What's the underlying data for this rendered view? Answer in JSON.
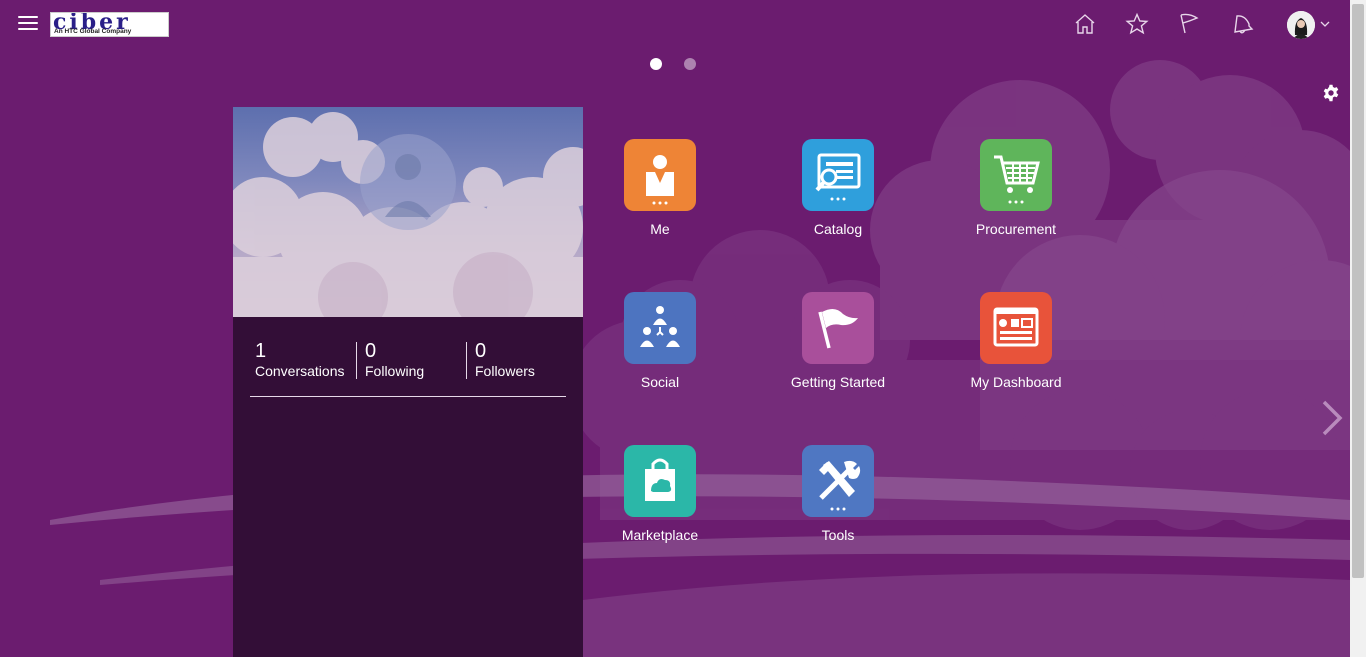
{
  "header": {
    "logo_text": "ciber",
    "logo_subtext": "An HTC Global Company",
    "icons": [
      "menu-icon",
      "home-icon",
      "star-icon",
      "flag-icon",
      "bell-icon",
      "user-avatar"
    ]
  },
  "pager": {
    "pages": 2,
    "active_index": 0
  },
  "profile": {
    "stats": [
      {
        "value": "1",
        "label": "Conversations"
      },
      {
        "value": "0",
        "label": "Following"
      },
      {
        "value": "0",
        "label": "Followers"
      }
    ]
  },
  "apps": [
    {
      "label": "Me",
      "icon": "person-icon",
      "color": "#ee8436"
    },
    {
      "label": "Catalog",
      "icon": "catalog-search-icon",
      "color": "#2f9fdc"
    },
    {
      "label": "Procurement",
      "icon": "shopping-cart-icon",
      "color": "#5fb55b"
    },
    {
      "label": "Social",
      "icon": "social-network-icon",
      "color": "#4d74c0"
    },
    {
      "label": "Getting Started",
      "icon": "flag-icon",
      "color": "#a94f9b"
    },
    {
      "label": "My Dashboard",
      "icon": "dashboard-icon",
      "color": "#e8533a"
    },
    {
      "label": "Marketplace",
      "icon": "shopping-bag-icon",
      "color": "#2bb7a8"
    },
    {
      "label": "Tools",
      "icon": "tools-icon",
      "color": "#4f77c2"
    }
  ],
  "colors": {
    "background": "#6b1c6f",
    "panel": "#330e37"
  }
}
